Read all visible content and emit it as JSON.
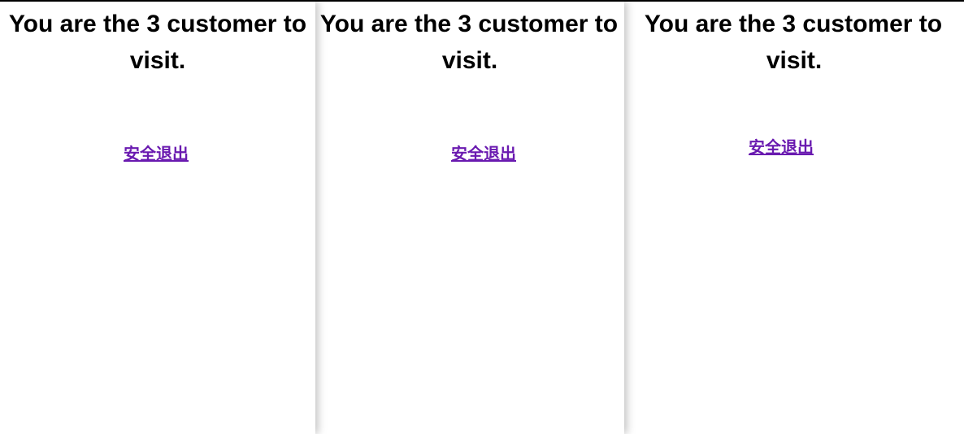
{
  "panels": [
    {
      "heading_line1": "You are the 3 customer to",
      "heading_line2": "visit.",
      "logout_label": "安全退出"
    },
    {
      "heading_line1": "You are the 3 customer to",
      "heading_line2": "visit.",
      "logout_label": "安全退出"
    },
    {
      "heading_line1": "You are the 3 customer to",
      "heading_line2": "visit.",
      "logout_label": "安全退出"
    }
  ]
}
